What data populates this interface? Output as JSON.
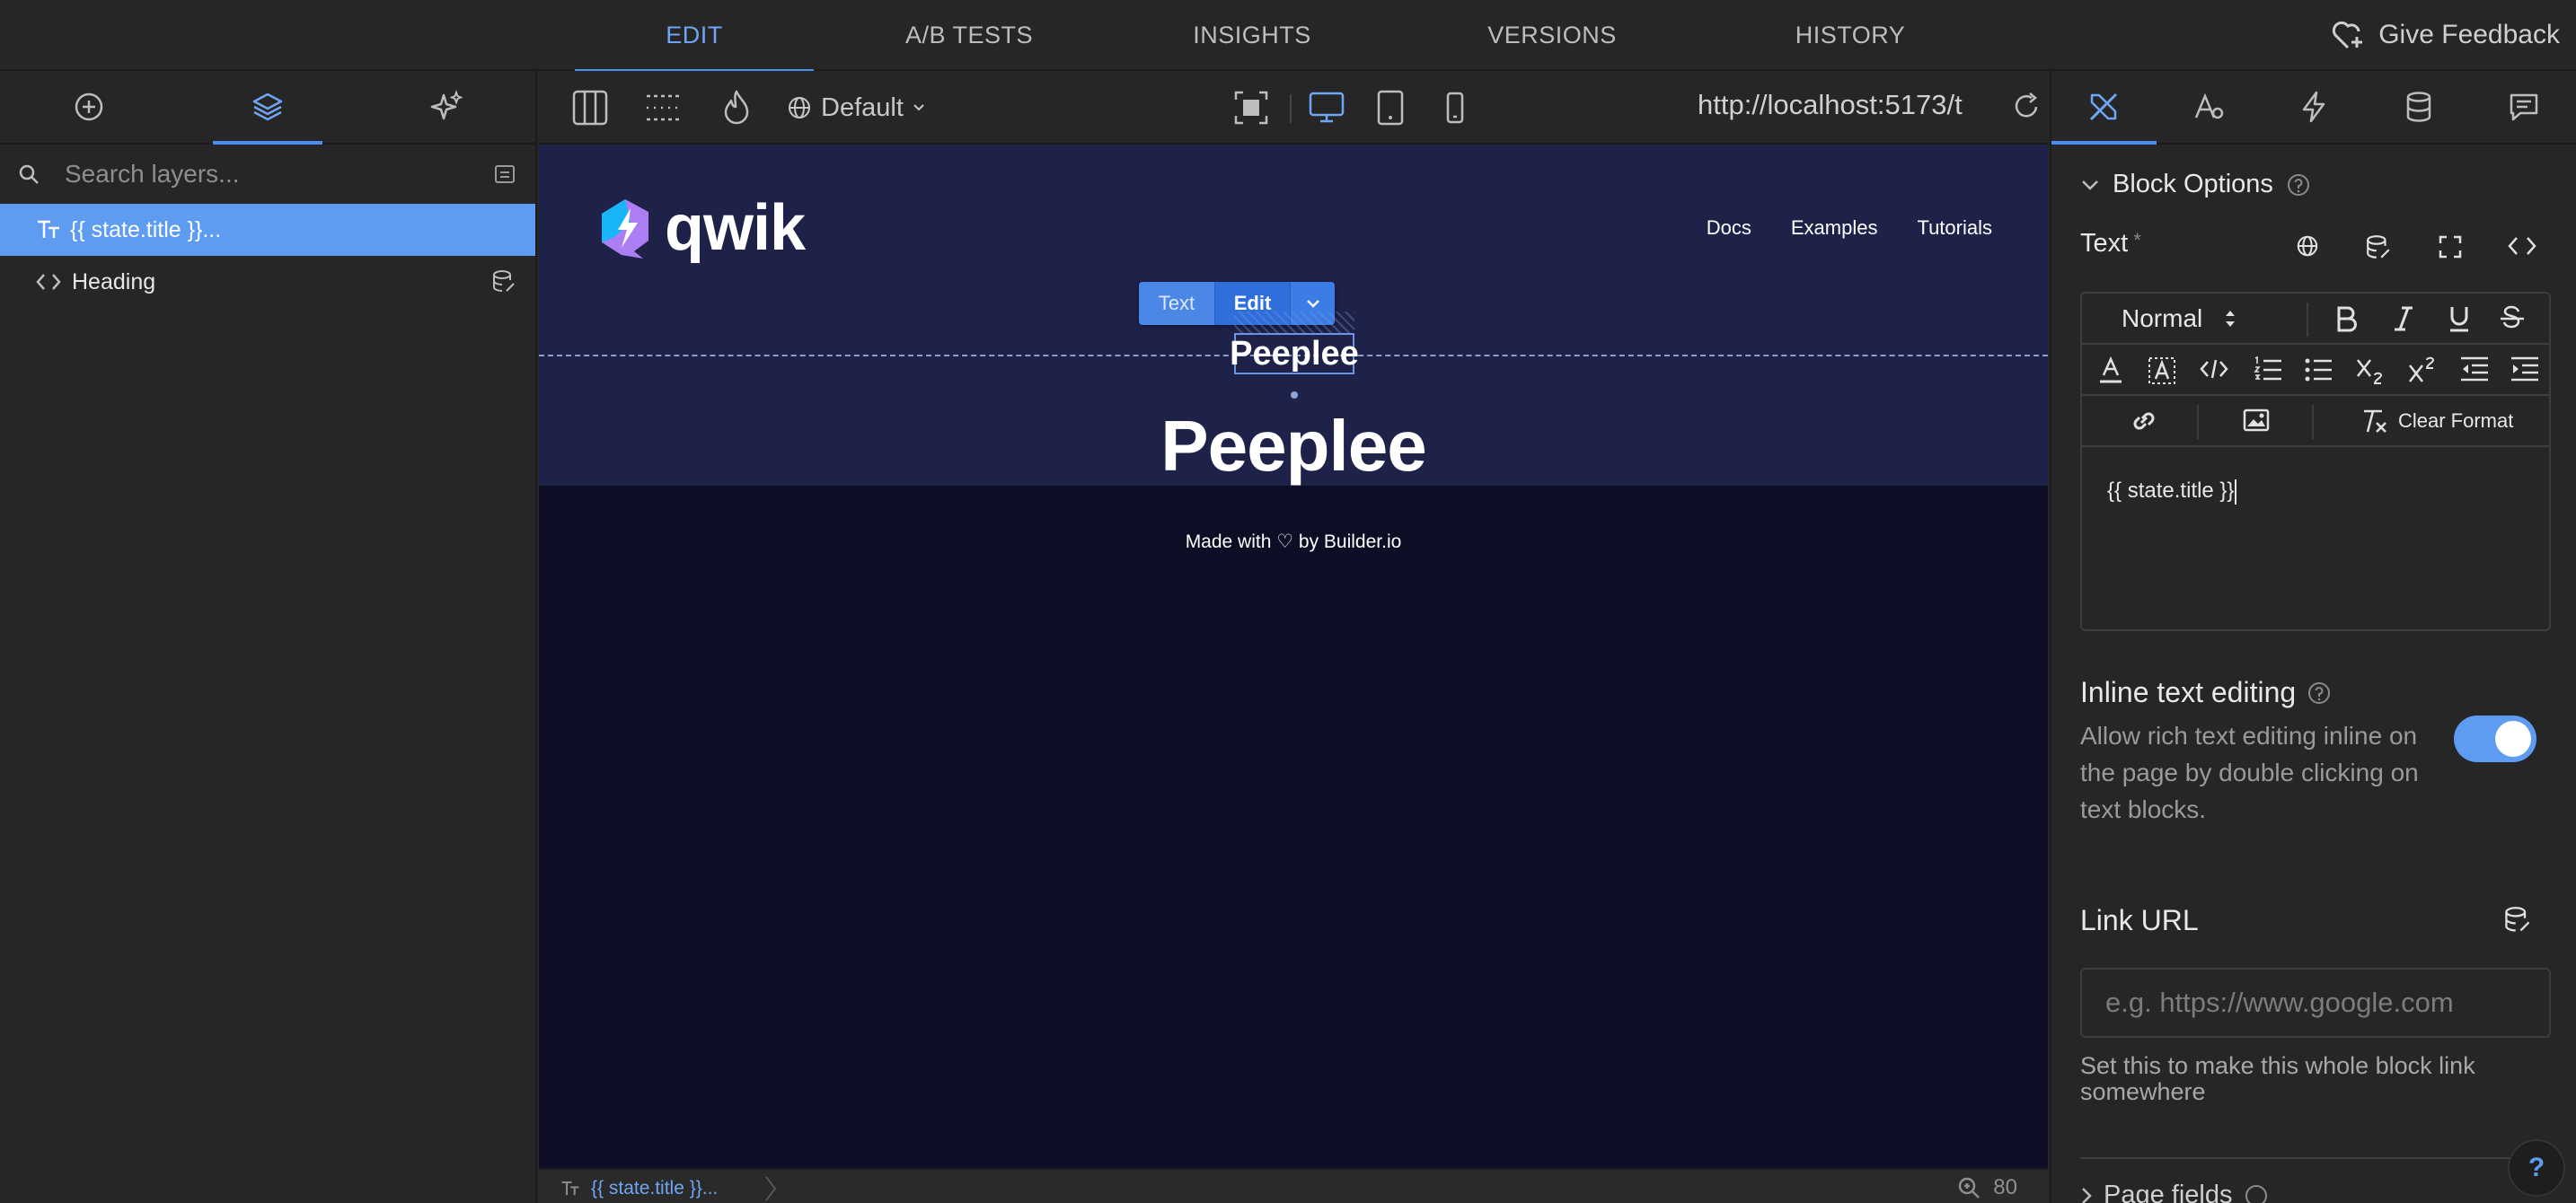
{
  "topnav": {
    "tabs": [
      {
        "label": "EDIT",
        "active": true
      },
      {
        "label": "A/B TESTS"
      },
      {
        "label": "INSIGHTS"
      },
      {
        "label": "VERSIONS"
      },
      {
        "label": "HISTORY"
      }
    ],
    "feedback_label": "Give Feedback"
  },
  "left_panel": {
    "tab_icons": [
      "add-circle-icon",
      "layers-icon",
      "sparkle-icon"
    ],
    "search_placeholder": "Search layers...",
    "layers": [
      {
        "label": "{{ state.title }}...",
        "icon": "text-type-icon",
        "selected": true
      },
      {
        "label": "Heading",
        "icon": "code-brackets-icon",
        "bound_icon": "database-link-icon"
      }
    ]
  },
  "toolbar": {
    "locale_label": "Default",
    "url": "http://localhost:5173/t"
  },
  "canvas": {
    "brand": "qwik",
    "nav_links": [
      "Docs",
      "Examples",
      "Tutorials"
    ],
    "inline_toolbar": {
      "type_label": "Text",
      "edit_label": "Edit"
    },
    "selected_text": "Peeplee",
    "title": "Peeplee",
    "footer": "Made with ♡ by Builder.io"
  },
  "statusbar": {
    "breadcrumb": "{{ state.title }}...",
    "zoom": "80"
  },
  "right_panel": {
    "tab_icons": [
      "style-tools-icon",
      "typography-icon",
      "lightning-icon",
      "database-icon",
      "comment-icon"
    ],
    "section_title": "Block Options",
    "text_field_label": "Text",
    "text_required_mark": "*",
    "format_select": "Normal",
    "clear_format_label": "Clear Format",
    "editor_content": "{{ state.title }}",
    "inline_editing": {
      "label": "Inline text editing",
      "description": "Allow rich text editing inline on the page by double clicking on text blocks.",
      "enabled": true
    },
    "link_url": {
      "label": "Link URL",
      "placeholder": "e.g. https://www.google.com",
      "help": "Set this to make this whole block link somewhere"
    },
    "next_section": "Page fields",
    "help_button": "?"
  },
  "colors": {
    "accent": "#4a8ef0",
    "selection": "#5e9cf2",
    "hero_bg": "#1e2249",
    "page_bg": "#0d0d26"
  }
}
